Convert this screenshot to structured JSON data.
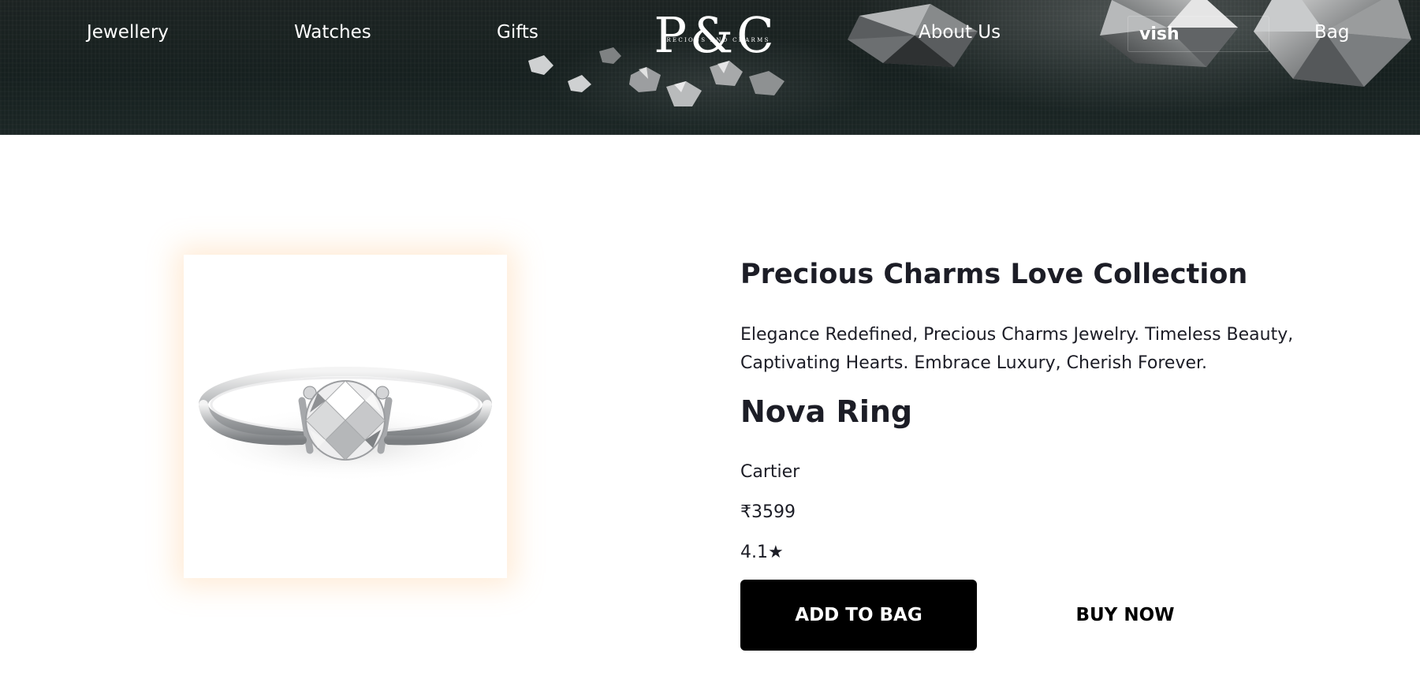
{
  "nav": {
    "jewellery": "Jewellery",
    "watches": "Watches",
    "gifts": "Gifts",
    "about": "About Us",
    "wishlist": "vish",
    "bag": "Bag"
  },
  "logo": {
    "mark": "P&C",
    "tagline": "PRECIOUS AND CHARMS"
  },
  "product": {
    "collection_title": "Precious Charms Love Collection",
    "description": "Elegance Redefined, Precious Charms Jewelry. Timeless Beauty, Captivating Hearts. Embrace Luxury, Cherish Forever.",
    "name": "Nova Ring",
    "brand": "Cartier",
    "price": "₹3599",
    "rating": "4.1",
    "rating_icon": "star-icon",
    "image_icon": "solitaire-ring-image"
  },
  "actions": {
    "add_to_bag": "ADD TO BAG",
    "buy_now": "BUY NOW"
  },
  "colors": {
    "header_bg": "#1c2322",
    "text": "#1c1d26",
    "button_bg": "#000000",
    "image_glow": "#ffbe78"
  }
}
